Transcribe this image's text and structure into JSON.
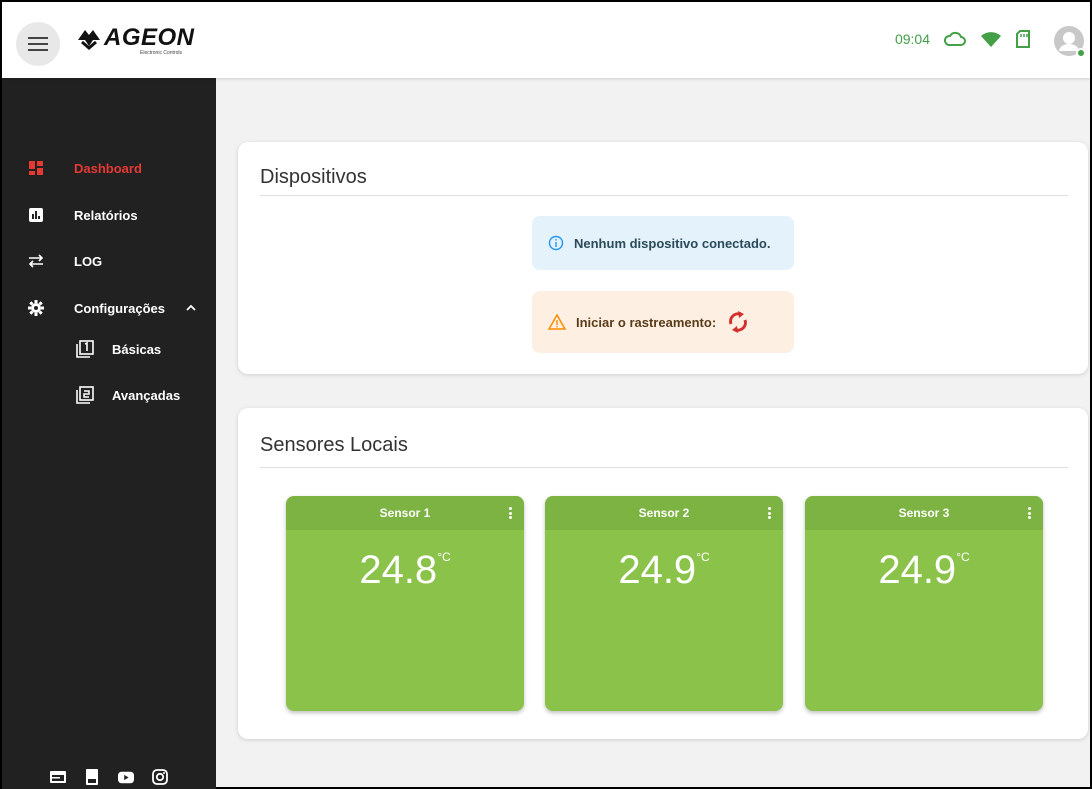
{
  "header": {
    "logo_text": "AGEON",
    "logo_subtext": "Electronic Controls",
    "time": "09:04"
  },
  "sidebar": {
    "items": [
      {
        "label": "Dashboard",
        "icon": "dashboard-icon",
        "active": true
      },
      {
        "label": "Relatórios",
        "icon": "bar-chart-icon"
      },
      {
        "label": "LOG",
        "icon": "swap-arrows-icon"
      },
      {
        "label": "Configurações",
        "icon": "gear-icon",
        "expanded": true
      }
    ],
    "subitems": [
      {
        "label": "Básicas",
        "icon": "filter-1-icon"
      },
      {
        "label": "Avançadas",
        "icon": "filter-2-icon"
      }
    ],
    "footer_icons": [
      "web-icon",
      "book-icon",
      "youtube-icon",
      "instagram-icon"
    ]
  },
  "devices_card": {
    "title": "Dispositivos",
    "info_message": "Nenhum dispositivo conectado.",
    "warn_message": "Iniciar o rastreamento:"
  },
  "sensors_card": {
    "title": "Sensores Locais",
    "sensors": [
      {
        "name": "Sensor 1",
        "value": "24.8",
        "unit": "°C"
      },
      {
        "name": "Sensor 2",
        "value": "24.9",
        "unit": "°C"
      },
      {
        "name": "Sensor 3",
        "value": "24.9",
        "unit": "°C"
      }
    ]
  },
  "colors": {
    "accent_red": "#e53935",
    "status_green": "#43a047",
    "sensor_green": "#8bc34a",
    "sensor_header_green": "#7cb342",
    "sidebar_bg": "#212121"
  }
}
